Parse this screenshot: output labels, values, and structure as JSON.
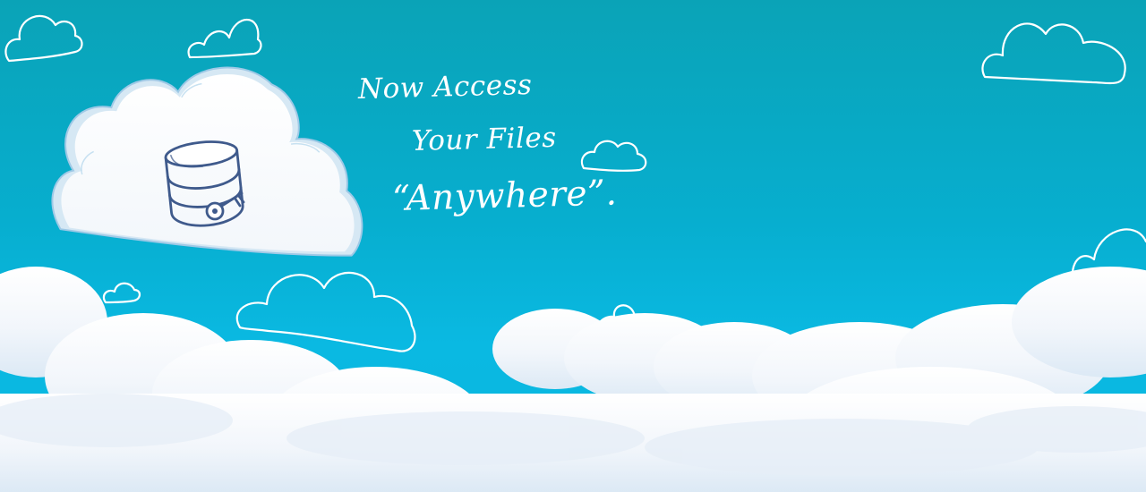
{
  "banner": {
    "line1": "Now Access",
    "line2": "Your Files",
    "line3": "“Anywhere”."
  },
  "colors": {
    "sky_top": "#0aa3b7",
    "sky_bottom": "#0ab6de",
    "cloud": "#ffffff",
    "cloud_shade": "#e3edf7",
    "database_ink": "#3f5a8c"
  },
  "icons": {
    "storage": "database-icon",
    "key": "key-icon"
  }
}
